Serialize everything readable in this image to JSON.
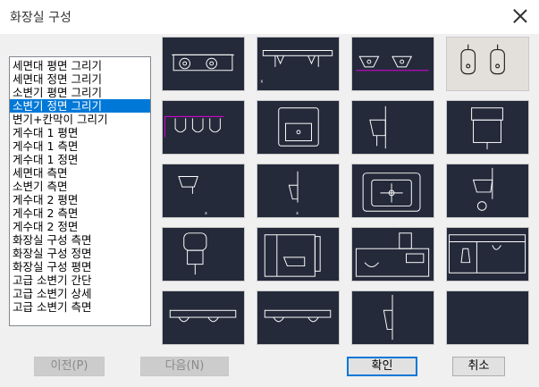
{
  "window": {
    "title": "화장실 구성"
  },
  "list": {
    "items": [
      "세면대 평면 그리기",
      "세면대 정면 그리기",
      "소변기 평면 그리기",
      "소변기 정면 그리기",
      "변기+칸막이 그리기",
      "게수대 1 평면",
      "게수대 1 측면",
      "게수대 1 정면",
      "세면대 측면",
      "소변기 측면",
      "게수대 2 평면",
      "게수대 2 측면",
      "게수대 2 정면",
      "화장실 구성 측면",
      "화장실 구성 정면",
      "화장실 구성 평면",
      "고급 소변기 간단",
      "고급 소변기 상세",
      "고급 소변기 측면"
    ],
    "selected_index": 3
  },
  "gallery": {
    "selected_index": 3
  },
  "buttons": {
    "prev": "이전(P)",
    "next": "다음(N)",
    "ok": "확인",
    "cancel": "취소"
  }
}
